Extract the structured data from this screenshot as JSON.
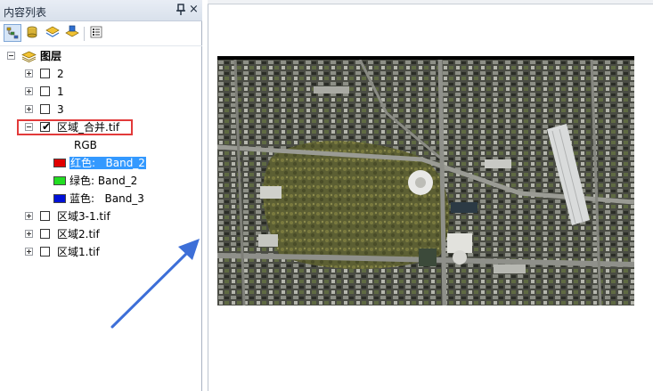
{
  "toc": {
    "title": "内容列表",
    "pin": "pin-icon",
    "close": "×",
    "toolbar": [
      "list-by-drawing-order-icon",
      "list-by-source-icon",
      "list-by-visibility-icon",
      "list-by-selection-icon",
      "options-icon"
    ],
    "root_label": "图层",
    "layers": [
      {
        "label": "2",
        "checked": false
      },
      {
        "label": "1",
        "checked": false
      },
      {
        "label": "3",
        "checked": false
      },
      {
        "label": "区域_合并.tif",
        "checked": true,
        "expanded": true
      },
      {
        "label": "区域3-1.tif",
        "checked": false
      },
      {
        "label": "区域2.tif",
        "checked": false
      },
      {
        "label": "区域1.tif",
        "checked": false
      }
    ],
    "rgb_label": "RGB",
    "bands": [
      {
        "name": "红色:",
        "band": "Band_2",
        "color": "#e00000",
        "selected": true
      },
      {
        "name": "绿色:",
        "band": "Band_2",
        "color": "#22dd22",
        "selected": false
      },
      {
        "name": "蓝色:",
        "band": "Band_3",
        "color": "#0010d8",
        "selected": false
      }
    ],
    "checkmark": "✔"
  },
  "colors": {
    "highlight_box": "#e23a3a",
    "arrow": "#3d6fd8",
    "selection": "#3399ff"
  }
}
